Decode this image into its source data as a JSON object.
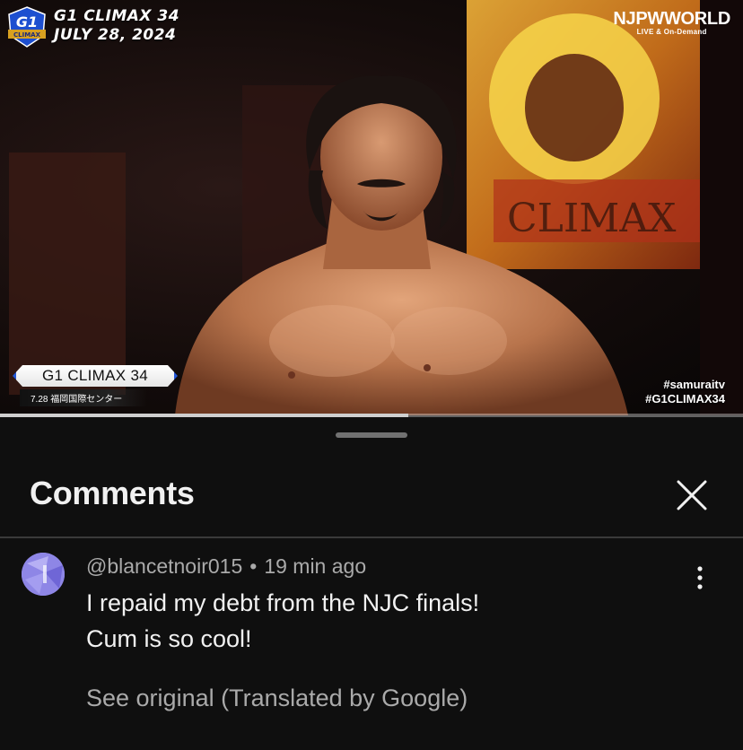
{
  "video": {
    "overlay": {
      "logo_text": "G1",
      "logo_badge": "CLIMAX",
      "title_line1": "G1 CLIMAX 34",
      "title_line2": "JULY 28, 2024"
    },
    "brand": {
      "name": "NJPWWORLD",
      "tagline": "LIVE & On-Demand"
    },
    "lower_third": {
      "title": "G1 CLIMAX 34",
      "date_venue": "7.28 福岡国際センター"
    },
    "hashtags": [
      "#samuraitv",
      "#G1CLIMAX34"
    ],
    "progress": 0.55,
    "backdrop_text": "CLIMAX"
  },
  "comments_panel": {
    "title": "Comments",
    "close_icon": "close-icon",
    "comment": {
      "author": "@blancetnoir015",
      "separator": "•",
      "time": "19 min ago",
      "lines": [
        "I repaid my debt from the NJC finals!",
        "Cum is so cool!"
      ],
      "see_original": "See original (Translated by Google)",
      "menu_icon": "more-vert-icon",
      "avatar_color": "#8e86e6"
    }
  },
  "colors": {
    "background": "#0f0f0f",
    "text_primary": "#f1f1f1",
    "text_secondary": "#aaaaaa",
    "accent_blue": "#2458d8"
  }
}
